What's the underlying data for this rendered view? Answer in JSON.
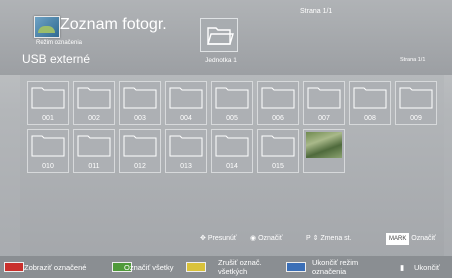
{
  "header": {
    "title": "Zoznam fotogr.",
    "mode": "Režim označenia",
    "source": "USB externé",
    "device_label": "Jednotka 1",
    "page_top": "Strana 1/1",
    "page_right": "Strana 1/1"
  },
  "tiles": {
    "row1": [
      "001",
      "002",
      "003",
      "004",
      "005",
      "006",
      "007",
      "008",
      "009"
    ],
    "row2": [
      "010",
      "011",
      "012",
      "013",
      "014",
      "015"
    ]
  },
  "help": {
    "move": "Presunúť",
    "select": "Označiť",
    "page_key": "P",
    "page_change": "Zmena st.",
    "mark_key": "MARK",
    "mark": "Označiť"
  },
  "bottom": {
    "red": "Zobraziť označené",
    "green": "Označiť všetky",
    "yellow": "Zrušiť označ. všetkých",
    "blue": "Ukončiť režim označenia",
    "exit": "Ukončiť"
  },
  "colors": {
    "red": "#c9302c",
    "green": "#4f9a3a",
    "yellow": "#d9c23b",
    "blue": "#3b6fb7"
  }
}
